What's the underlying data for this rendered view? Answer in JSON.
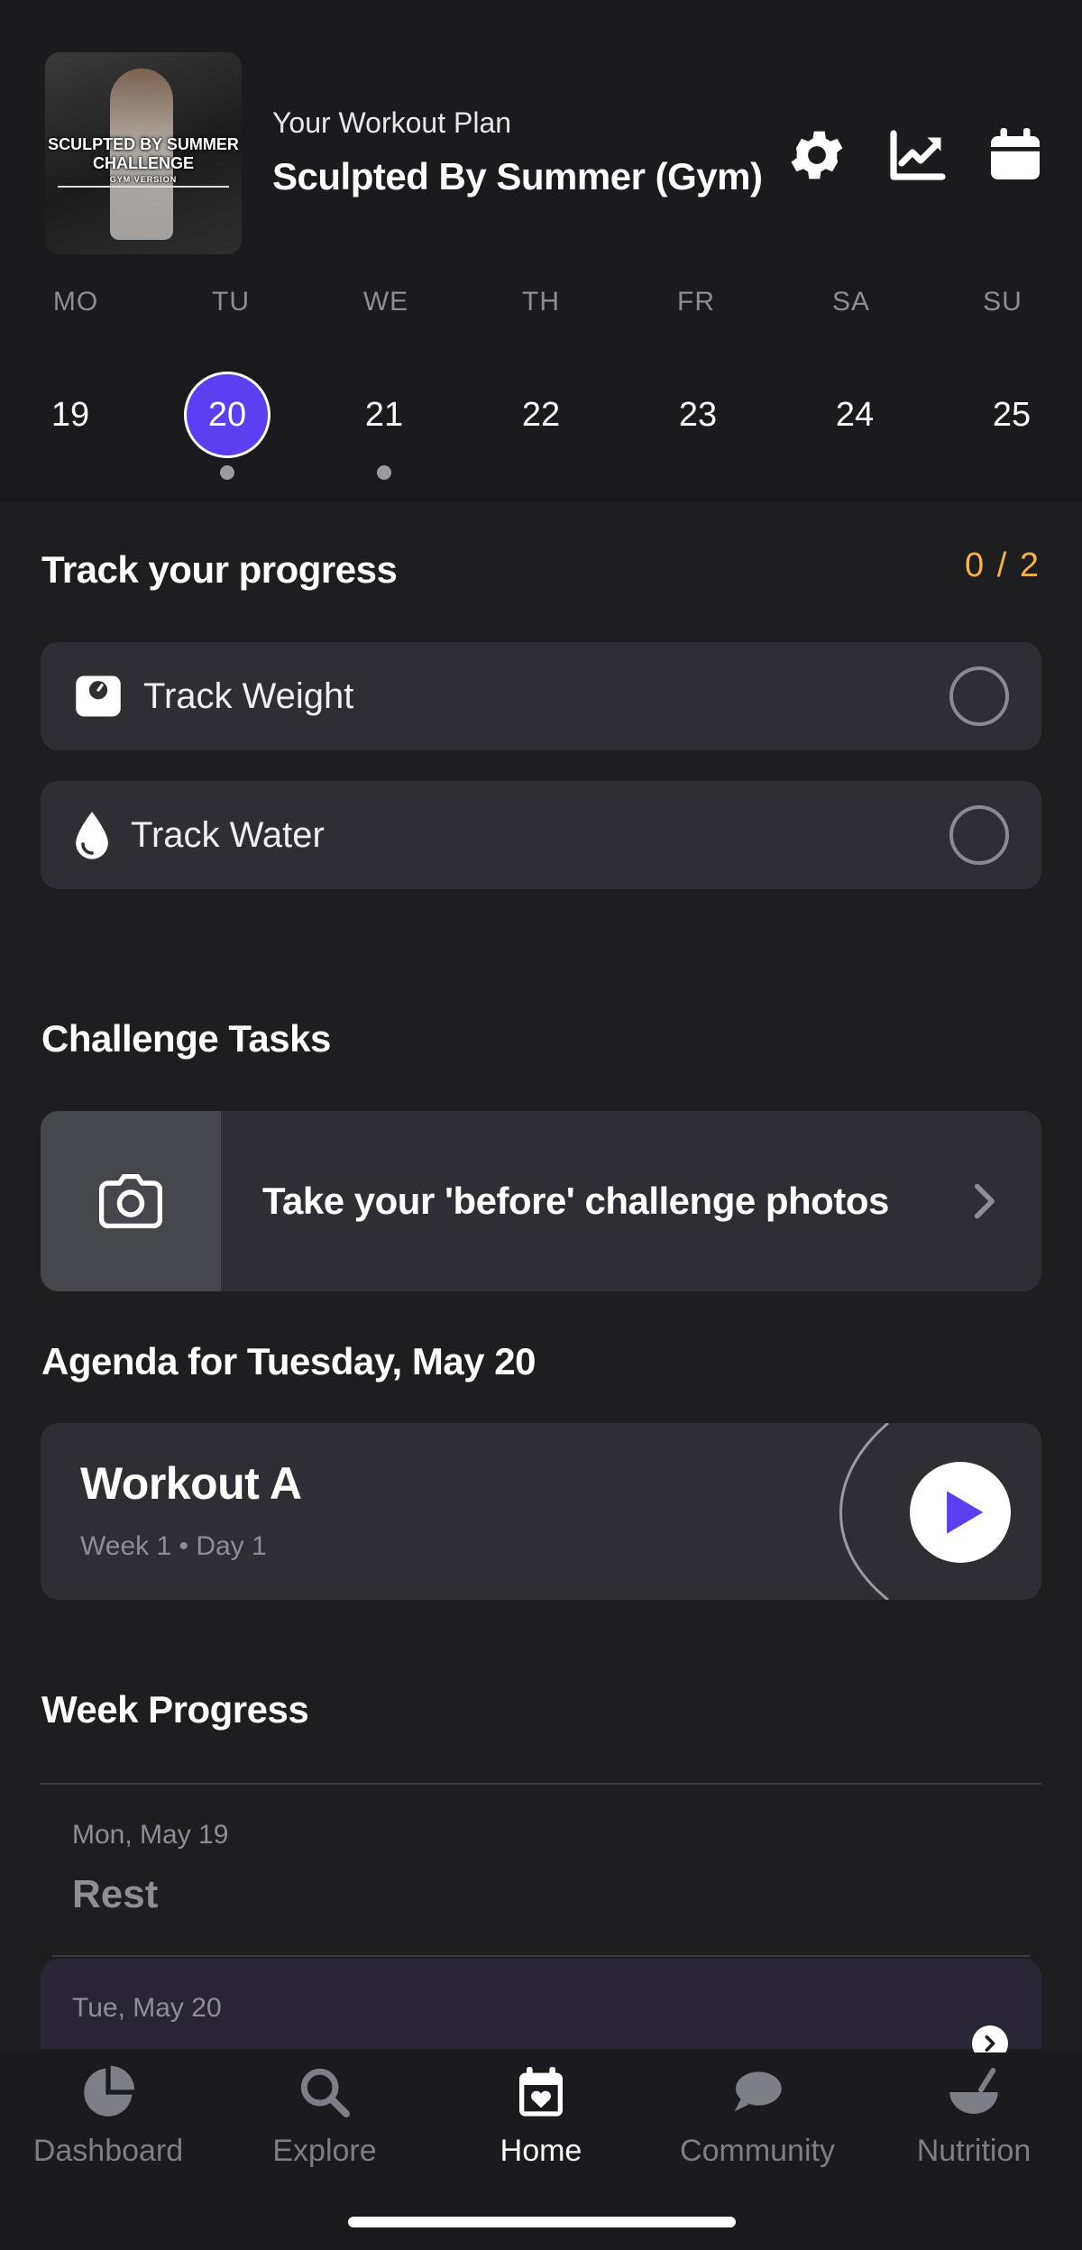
{
  "header": {
    "cover": {
      "title": "SCULPTED BY SUMMER CHALLENGE",
      "subtitle": "GYM VERSION"
    },
    "plan_label": "Your Workout Plan",
    "plan_title": "Sculpted By Summer (Gym)",
    "icons": [
      "gear-icon",
      "chart-line-icon",
      "calendar-icon"
    ]
  },
  "week": {
    "day_labels": [
      "MO",
      "TU",
      "WE",
      "TH",
      "FR",
      "SA",
      "SU"
    ],
    "dates": [
      "19",
      "20",
      "21",
      "22",
      "23",
      "24",
      "25"
    ],
    "selected_date": "20"
  },
  "progress": {
    "title": "Track your progress",
    "count": "0 / 2",
    "items": [
      {
        "label": "Track Weight",
        "icon": "scale-icon"
      },
      {
        "label": "Track Water",
        "icon": "water-drop-icon"
      }
    ]
  },
  "challenge": {
    "title": "Challenge Tasks",
    "task_label": "Take your 'before' challenge photos",
    "icon": "camera-icon"
  },
  "agenda": {
    "title": "Agenda for Tuesday, May 20",
    "workout_title": "Workout A",
    "workout_sub": "Week 1 • Day 1"
  },
  "week_progress": {
    "title": "Week Progress",
    "entries": [
      {
        "date": "Mon, May 19",
        "status": "Rest"
      },
      {
        "date": "Tue, May 20"
      }
    ]
  },
  "tabbar": {
    "tabs": [
      {
        "label": "Dashboard",
        "icon": "pie-chart-icon"
      },
      {
        "label": "Explore",
        "icon": "search-icon"
      },
      {
        "label": "Home",
        "icon": "calendar-heart-icon"
      },
      {
        "label": "Community",
        "icon": "chat-bubble-icon"
      },
      {
        "label": "Nutrition",
        "icon": "bowl-icon"
      }
    ],
    "active": "Home"
  },
  "colors": {
    "accent": "#5b3ff0",
    "count": "#f5b348",
    "background": "#1e1e21",
    "card": "#2e2e34"
  }
}
